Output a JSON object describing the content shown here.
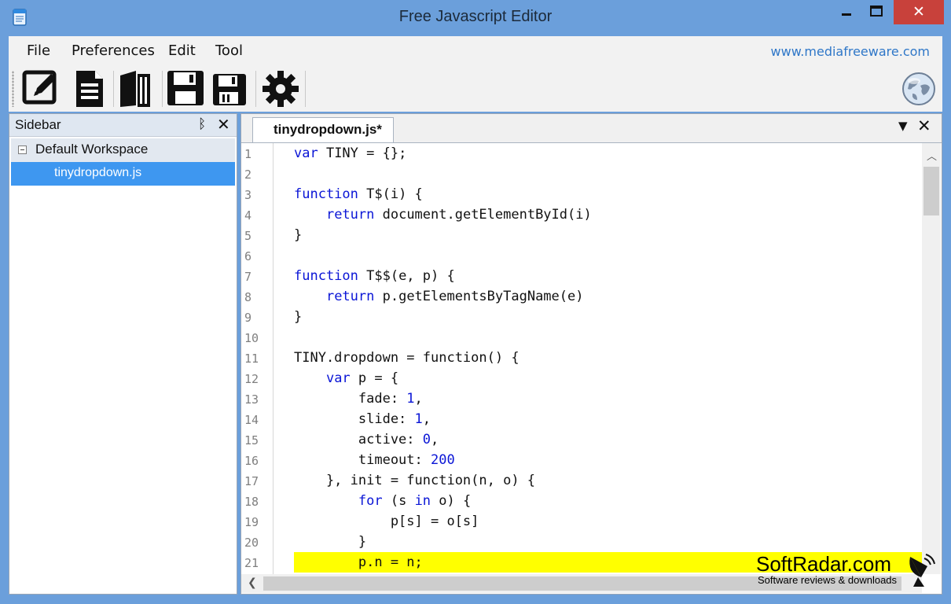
{
  "window": {
    "title": "Free Javascript Editor",
    "close_glyph": "✕",
    "min_glyph": "–",
    "max_glyph": "▢"
  },
  "menubar": {
    "items": [
      "File",
      "Preferences",
      "Edit",
      "Tool"
    ],
    "website": "www.mediafreeware.com"
  },
  "toolbar": {
    "buttons": [
      {
        "name": "edit-icon"
      },
      {
        "name": "new-document-icon"
      },
      {
        "name": "open-book-icon"
      },
      {
        "name": "save-icon"
      },
      {
        "name": "save-all-icon"
      },
      {
        "name": "settings-gear-icon"
      }
    ],
    "right_icon": "globe-icon"
  },
  "sidebar": {
    "title": "Sidebar",
    "pin_glyph": "ᛒ",
    "close_glyph": "✕",
    "tree": {
      "workspace": "Default Workspace",
      "file": "tinydropdown.js"
    }
  },
  "editor": {
    "tab_label": "tinydropdown.js*",
    "highlighted_line": 21,
    "lines": [
      {
        "n": "1",
        "tokens": [
          [
            "kw",
            "var"
          ],
          [
            "t",
            " TINY = {};"
          ]
        ]
      },
      {
        "n": "2",
        "tokens": []
      },
      {
        "n": "3",
        "tokens": [
          [
            "kw",
            "function"
          ],
          [
            "t",
            " T$(i) {"
          ]
        ]
      },
      {
        "n": "4",
        "tokens": [
          [
            "t",
            "    "
          ],
          [
            "kw",
            "return"
          ],
          [
            "t",
            " document.getElementById(i)"
          ]
        ]
      },
      {
        "n": "5",
        "tokens": [
          [
            "t",
            "}"
          ]
        ]
      },
      {
        "n": "6",
        "tokens": []
      },
      {
        "n": "7",
        "tokens": [
          [
            "kw",
            "function"
          ],
          [
            "t",
            " T$$(e, p) {"
          ]
        ]
      },
      {
        "n": "8",
        "tokens": [
          [
            "t",
            "    "
          ],
          [
            "kw",
            "return"
          ],
          [
            "t",
            " p.getElementsByTagName(e)"
          ]
        ]
      },
      {
        "n": "9",
        "tokens": [
          [
            "t",
            "}"
          ]
        ]
      },
      {
        "n": "10",
        "tokens": []
      },
      {
        "n": "11",
        "tokens": [
          [
            "t",
            "TINY.dropdown = function() {"
          ]
        ]
      },
      {
        "n": "12",
        "tokens": [
          [
            "t",
            "    "
          ],
          [
            "kw",
            "var"
          ],
          [
            "t",
            " p = {"
          ]
        ]
      },
      {
        "n": "13",
        "tokens": [
          [
            "t",
            "        fade: "
          ],
          [
            "num",
            "1"
          ],
          [
            "t",
            ","
          ]
        ]
      },
      {
        "n": "14",
        "tokens": [
          [
            "t",
            "        slide: "
          ],
          [
            "num",
            "1"
          ],
          [
            "t",
            ","
          ]
        ]
      },
      {
        "n": "15",
        "tokens": [
          [
            "t",
            "        active: "
          ],
          [
            "num",
            "0"
          ],
          [
            "t",
            ","
          ]
        ]
      },
      {
        "n": "16",
        "tokens": [
          [
            "t",
            "        timeout: "
          ],
          [
            "num",
            "200"
          ]
        ]
      },
      {
        "n": "17",
        "tokens": [
          [
            "t",
            "    }, init = function(n, o) {"
          ]
        ]
      },
      {
        "n": "18",
        "tokens": [
          [
            "t",
            "        "
          ],
          [
            "kw",
            "for"
          ],
          [
            "t",
            " (s "
          ],
          [
            "kw",
            "in"
          ],
          [
            "t",
            " o) {"
          ]
        ]
      },
      {
        "n": "19",
        "tokens": [
          [
            "t",
            "            p[s] = o[s]"
          ]
        ]
      },
      {
        "n": "20",
        "tokens": [
          [
            "t",
            "        }"
          ]
        ]
      },
      {
        "n": "21",
        "tokens": [
          [
            "t",
            "        p.n = n;"
          ]
        ]
      }
    ]
  },
  "watermark": {
    "title": "SoftRadar.com",
    "subtitle": "Software reviews & downloads"
  },
  "colors": {
    "frame": "#6b9fdb",
    "selection": "#3e97f0",
    "keyword": "#0a15d6",
    "highlight": "#ffff00",
    "link": "#2f77c8",
    "close": "#c8413b"
  }
}
